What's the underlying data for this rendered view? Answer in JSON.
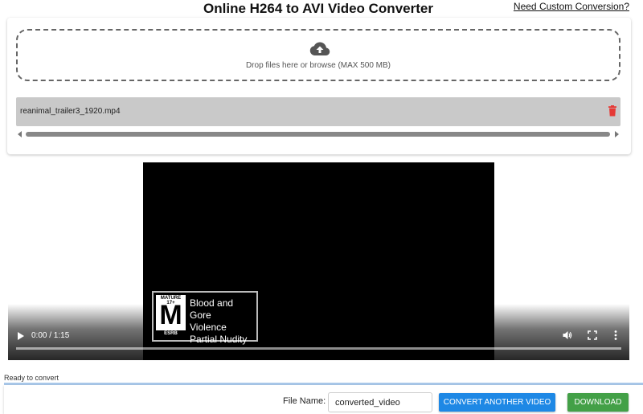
{
  "header": {
    "title": "Online H264 to AVI Video Converter",
    "custom_link": "Need Custom Conversion?"
  },
  "upload": {
    "icon": "cloud-upload-icon",
    "drop_text": "Drop files here or browse (MAX 500 MB)",
    "files": [
      {
        "name": "reanimal_trailer3_1920.mp4",
        "action_icon": "trash-icon",
        "action_color": "#e53935"
      }
    ]
  },
  "video": {
    "esrb": {
      "rating_top": "MATURE 17+",
      "rating_letter": "M",
      "rating_bottom": "ESRB",
      "descriptors": [
        "Blood and Gore",
        "Violence",
        "Partial Nudity"
      ]
    },
    "time": "0:00 / 1:15",
    "progress": 0,
    "icons": [
      "play-icon",
      "volume-icon",
      "fullscreen-icon",
      "more-options-icon"
    ]
  },
  "status": {
    "text": "Ready to convert"
  },
  "footer": {
    "file_name_label": "File Name:",
    "file_name_value": "converted_video",
    "convert_button": "CONVERT ANOTHER VIDEO",
    "download_button": "DOWNLOAD",
    "colors": {
      "convert": "#1e88e5",
      "download": "#43a047",
      "divider": "#a9c8ea"
    }
  }
}
